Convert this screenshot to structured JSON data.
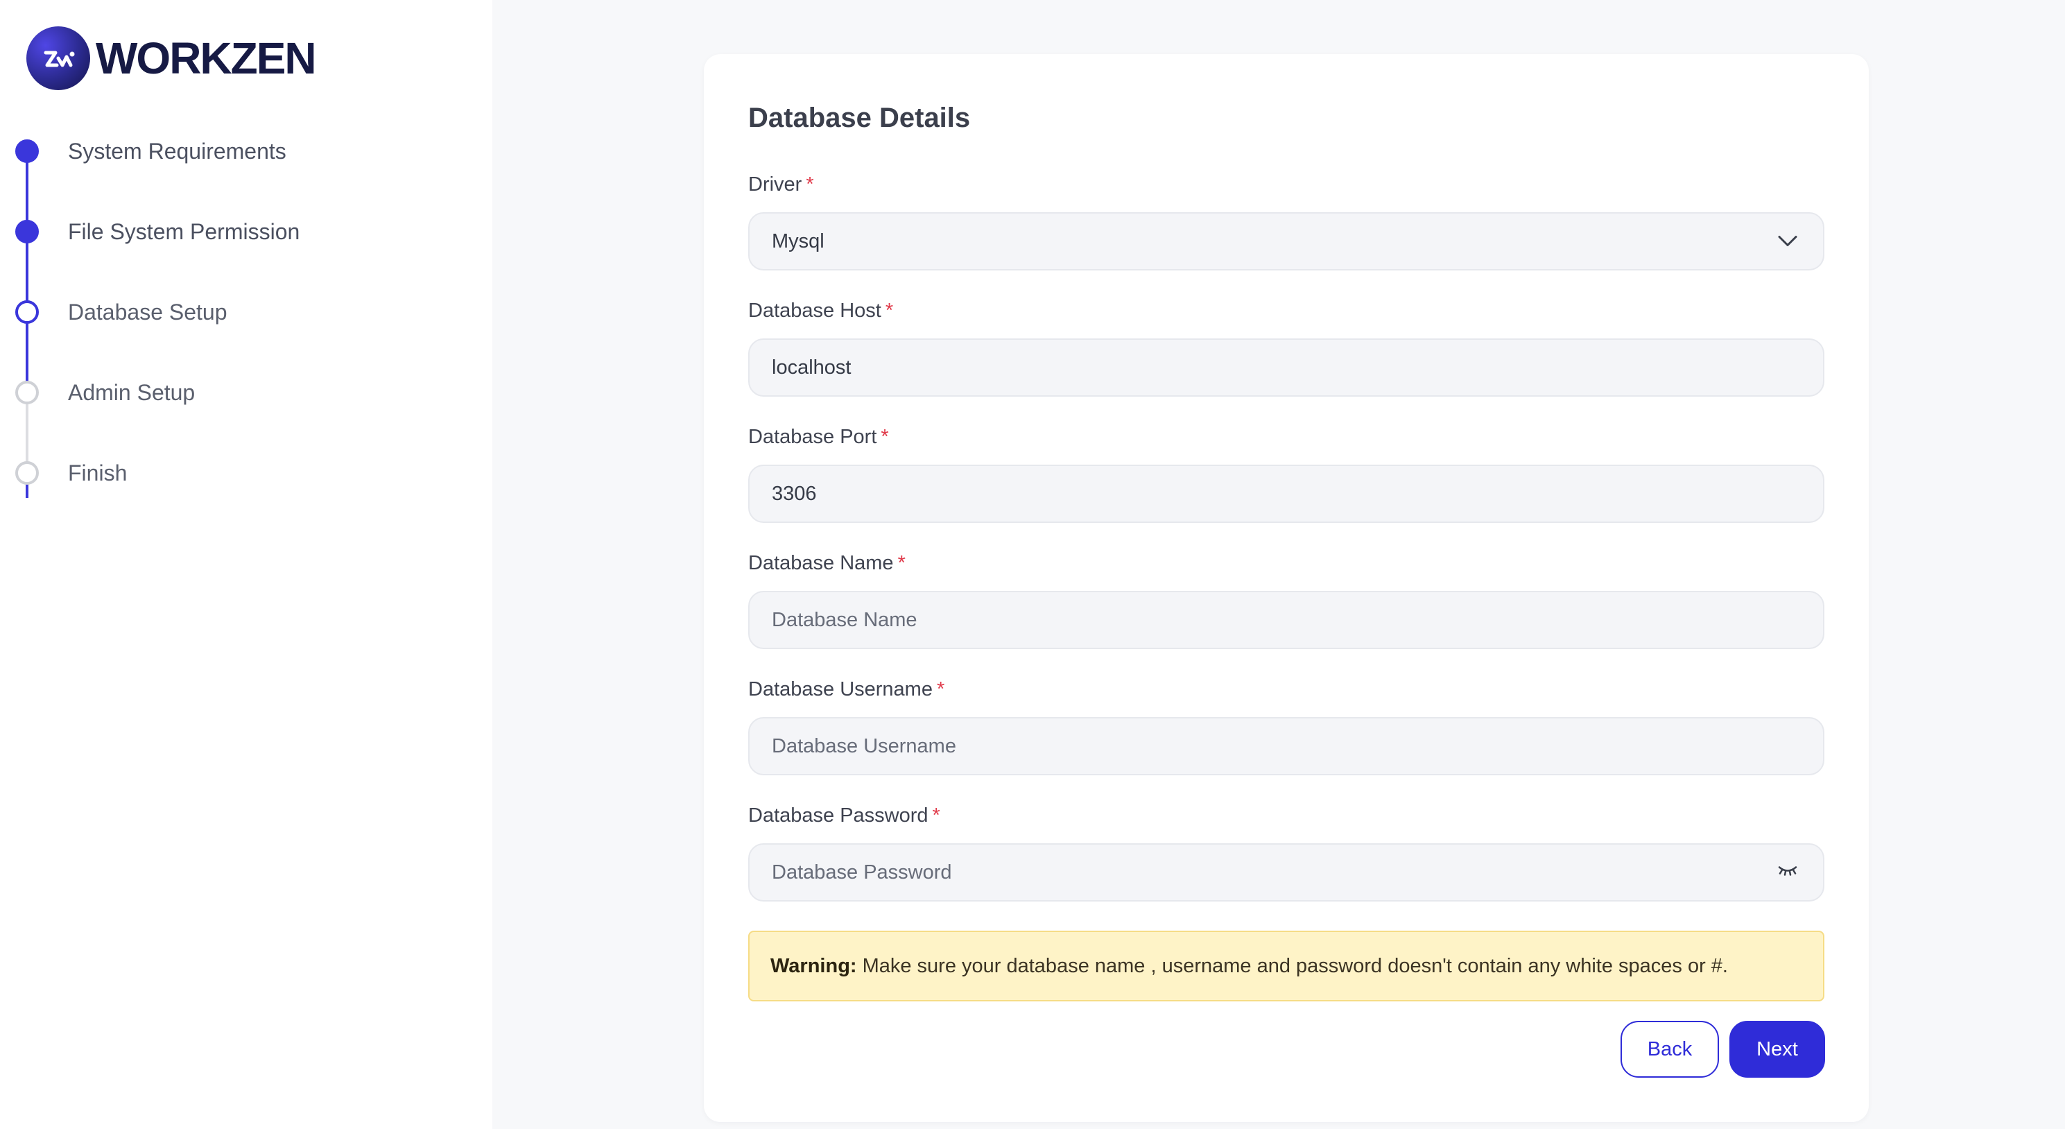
{
  "brand": {
    "name": "WORKZEN",
    "accent": "#3a36db"
  },
  "steps": [
    {
      "label": "System Requirements",
      "state": "done"
    },
    {
      "label": "File System Permission",
      "state": "done"
    },
    {
      "label": "Database Setup",
      "state": "current"
    },
    {
      "label": "Admin Setup",
      "state": "pending"
    },
    {
      "label": "Finish",
      "state": "pending"
    }
  ],
  "form": {
    "title": "Database Details",
    "required_mark": "*",
    "driver": {
      "label": "Driver",
      "value": "Mysql",
      "icon": "chevron-down-icon"
    },
    "host": {
      "label": "Database Host",
      "value": "localhost"
    },
    "port": {
      "label": "Database Port",
      "value": "3306"
    },
    "name": {
      "label": "Database Name",
      "value": "",
      "placeholder": "Database Name"
    },
    "username": {
      "label": "Database Username",
      "value": "",
      "placeholder": "Database Username"
    },
    "password": {
      "label": "Database Password",
      "value": "",
      "placeholder": "Database Password",
      "icon": "eye-closed-icon"
    }
  },
  "warning": {
    "prefix": "Warning:",
    "text": "Make sure your database name , username and password doesn't contain any white spaces or #."
  },
  "buttons": {
    "back": "Back",
    "next": "Next"
  }
}
